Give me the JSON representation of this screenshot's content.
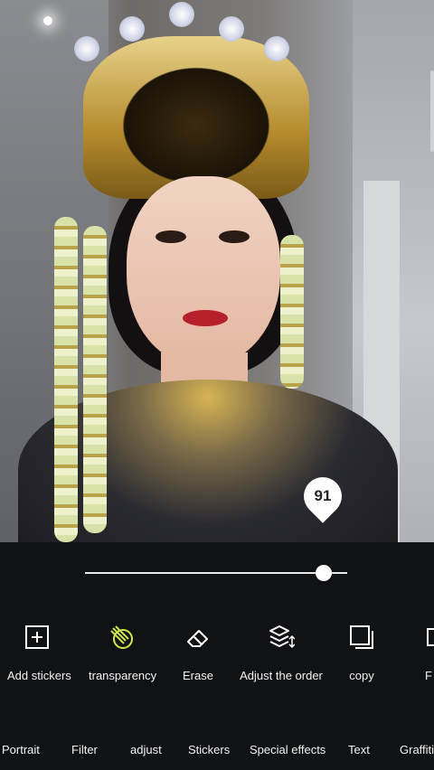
{
  "editor": {
    "badge_value": "91",
    "transparency_value": 0.91
  },
  "tools": [
    {
      "label": "Add stickers",
      "icon": "add-sticker-icon"
    },
    {
      "label": "transparency",
      "icon": "transparency-icon",
      "active": true
    },
    {
      "label": "Erase",
      "icon": "eraser-icon"
    },
    {
      "label": "Adjust the order",
      "icon": "layers-order-icon"
    },
    {
      "label": "copy",
      "icon": "copy-icon"
    },
    {
      "label": "F",
      "icon": "partial-icon"
    }
  ],
  "tabs": [
    "Portrait",
    "Filter",
    "adjust",
    "Stickers",
    "Special effects",
    "Text",
    "Graffiti"
  ],
  "colors": {
    "accent": "#cfe84a",
    "background": "#111214"
  }
}
